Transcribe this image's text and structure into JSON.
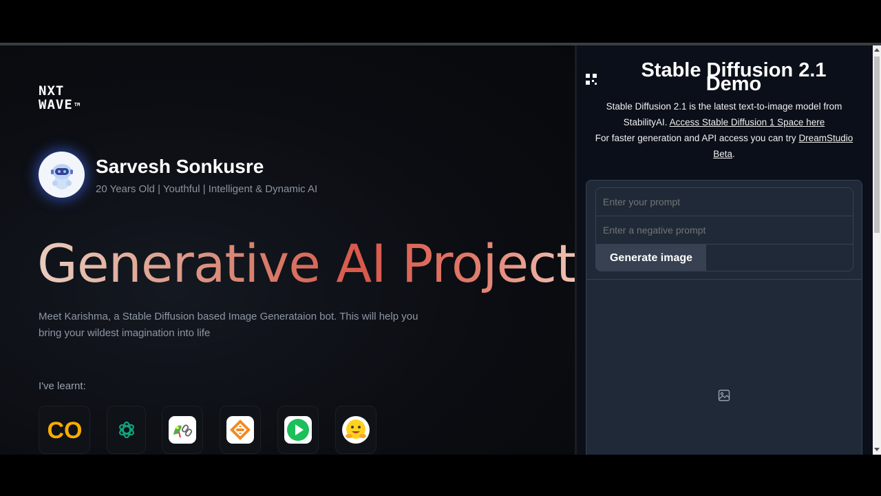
{
  "brand": {
    "line1": "NXT",
    "line2": "WAVE",
    "tm": "TM"
  },
  "profile": {
    "name": "Sarvesh Sonkusre",
    "tagline": "20 Years Old | Youthful | Intelligent & Dynamic AI"
  },
  "hero": {
    "title": "Generative AI Project",
    "description": "Meet Karishma, a Stable Diffusion based Image Generataion bot. This will help you bring your wildest imagination into life"
  },
  "skills": {
    "heading": "I've learnt:",
    "tools": [
      {
        "icon": "colab-icon",
        "label": "CO"
      },
      {
        "icon": "openai-icon"
      },
      {
        "icon": "langchain-icon"
      },
      {
        "icon": "stack-layers-icon"
      },
      {
        "icon": "play-icon"
      },
      {
        "icon": "huggingface-icon"
      }
    ]
  },
  "demo": {
    "title": "Stable Diffusion 2.1 Demo",
    "line1": "Stable Diffusion 2.1 is the latest text-to-image model from StabilityAI.",
    "link1": "Access Stable Diffusion 1 Space here",
    "line2": "For faster generation and API access you can try",
    "link2": "DreamStudio Beta",
    "end": ".",
    "prompt_placeholder": "Enter your prompt",
    "negative_placeholder": "Enter a negative prompt",
    "generate_label": "Generate image"
  },
  "colors": {
    "left_bg": "#0b0d12",
    "right_bg": "#0b0f19",
    "card_bg": "#1f2937",
    "border": "#374151",
    "accent_gradient_start": "#e9cdbf",
    "accent_gradient_mid": "#d8584a"
  }
}
